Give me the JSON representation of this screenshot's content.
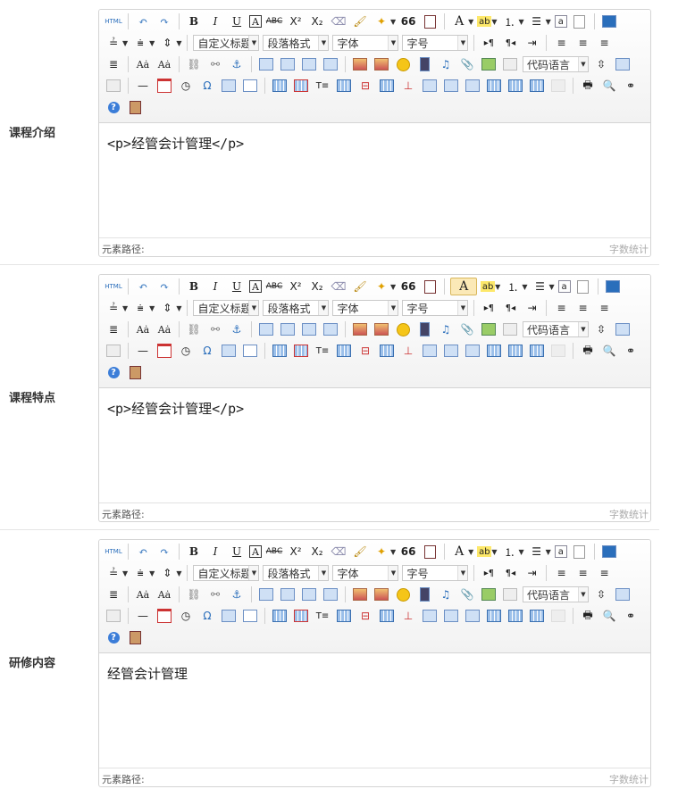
{
  "toolbar": {
    "html_label": "HTML",
    "custom_title": "自定义标题",
    "paragraph_format": "段落格式",
    "font_family": "字体",
    "font_size": "字号",
    "code_language": "代码语言",
    "bold": "B",
    "italic": "I",
    "underline": "U",
    "font_border": "A",
    "strike": "ABC",
    "superscript": "X²",
    "subscript": "X₂",
    "quote": "66",
    "forecolor": "A",
    "omega": "Ω",
    "help": "?"
  },
  "fields": [
    {
      "label": "课程介绍",
      "content": "<p>经管会计管理</p>",
      "status_path": "元素路径:",
      "word_count": "字数统计"
    },
    {
      "label": "课程特点",
      "content": "<p>经管会计管理</p>",
      "status_path": "元素路径:",
      "word_count": "字数统计"
    },
    {
      "label": "研修内容",
      "content": "经管会计管理",
      "status_path": "元素路径:",
      "word_count": "字数统计"
    }
  ]
}
